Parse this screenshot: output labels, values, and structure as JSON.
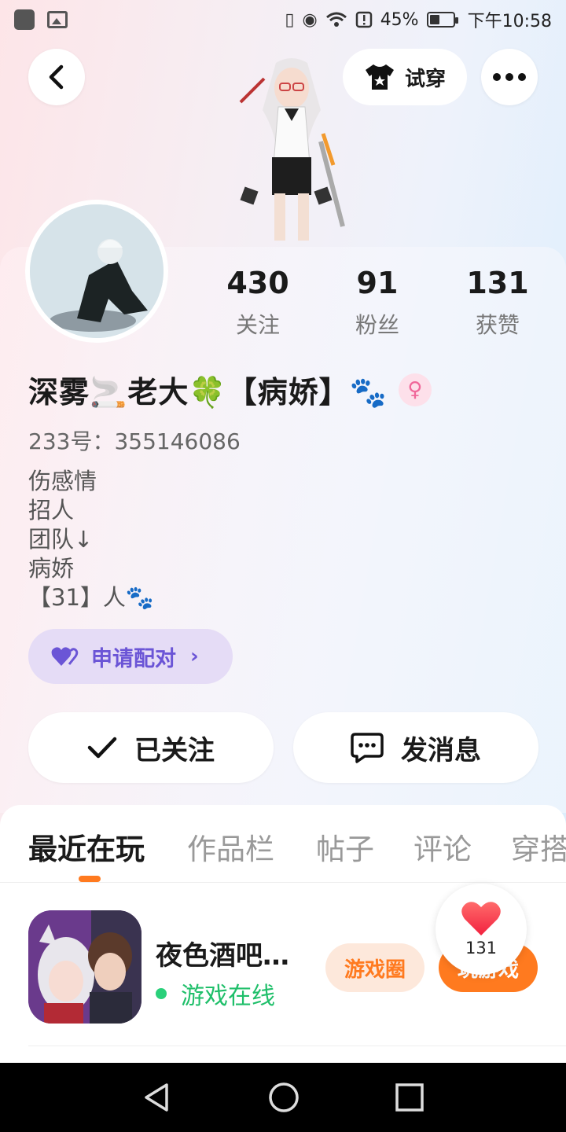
{
  "status_bar": {
    "battery": "45%",
    "time": "下午10:58"
  },
  "header": {
    "try_on_label": "试穿"
  },
  "stats": [
    {
      "count": "430",
      "label": "关注"
    },
    {
      "count": "91",
      "label": "粉丝"
    },
    {
      "count": "131",
      "label": "获赞"
    }
  ],
  "profile": {
    "name": "深雾🚬老大🍀【病娇】🐾",
    "uid": "233号：355146086",
    "bio": [
      "伤感情",
      "招人",
      "团队↓",
      "病娇",
      "【31】人🐾"
    ]
  },
  "match_button": {
    "label": "申请配对"
  },
  "actions": {
    "follow_label": "已关注",
    "message_label": "发消息"
  },
  "tabs": [
    {
      "label": "最近在玩"
    },
    {
      "label": "作品栏"
    },
    {
      "label": "帖子"
    },
    {
      "label": "评论"
    },
    {
      "label": "穿搭"
    }
  ],
  "recent_game": {
    "title": "夜色酒吧…",
    "status": "游戏在线",
    "circle_label": "游戏圈",
    "play_label": "玩游戏"
  },
  "like_fab": {
    "count": "131"
  },
  "colors": {
    "accent": "#ff7a1f",
    "online": "#1fbf6a",
    "match": "#6b55d6"
  }
}
